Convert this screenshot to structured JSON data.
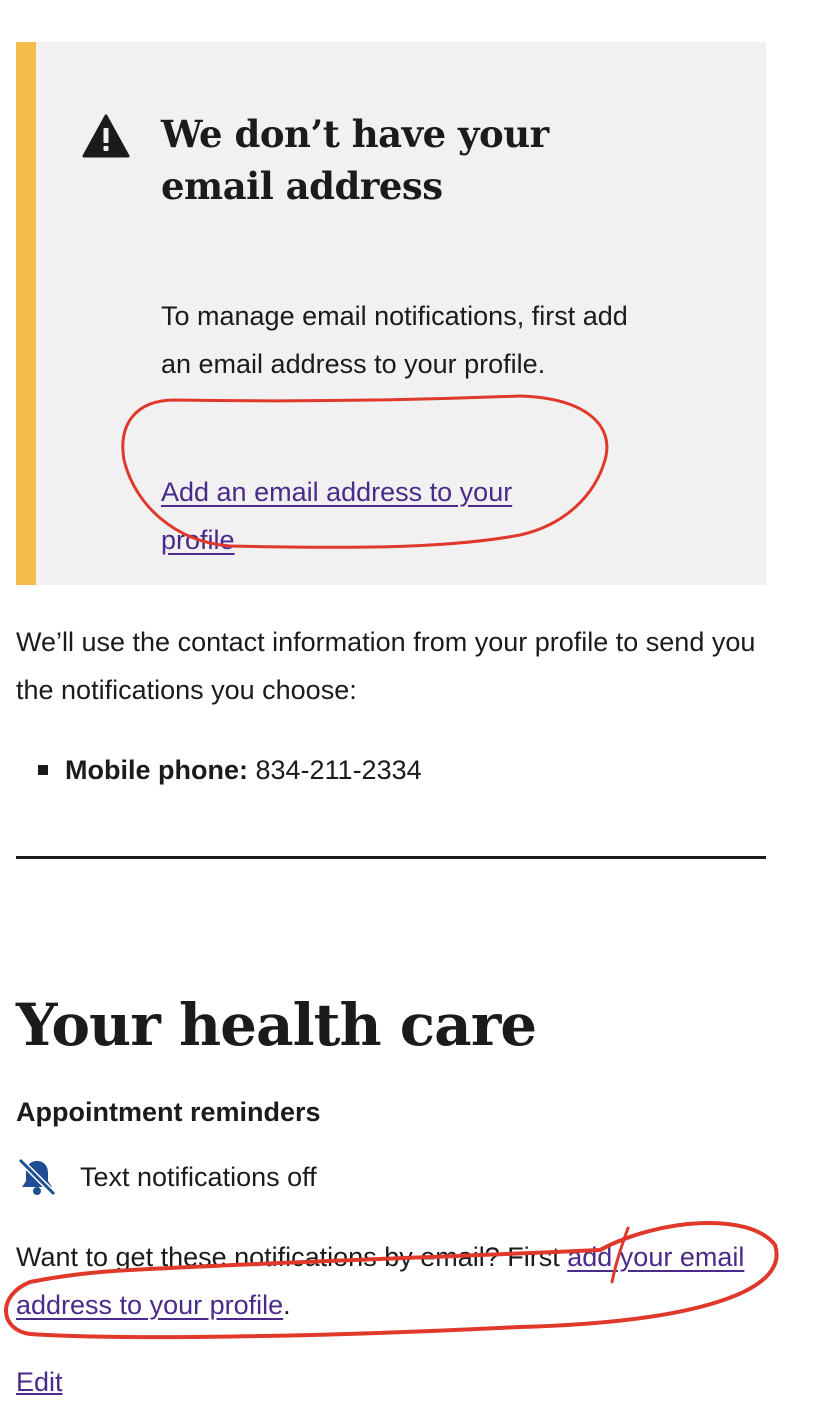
{
  "alert": {
    "heading": "We don’t have your email address",
    "body": "To manage email notifications, first add an email address to your profile.",
    "link_label": "Add an email address to your profile",
    "icon": "warning-icon",
    "accent_color": "#f4bc4a"
  },
  "contact": {
    "intro": "We’ll use the contact information from your profile to send you the notifications you choose:",
    "items": [
      {
        "label": "Mobile phone:",
        "value": " 834-211-2334"
      }
    ]
  },
  "health_care": {
    "title": "Your health care",
    "appointment_reminders": {
      "heading": "Appointment reminders",
      "status_icon": "bell-off-icon",
      "status": "Text notifications off",
      "prompt_text": "Want to get these notifications by email? First ",
      "prompt_link": "add your email address to your profile",
      "prompt_end": ".",
      "edit_label": "Edit"
    }
  },
  "colors": {
    "link": "#4a2a8a",
    "annotation": "#e0392b",
    "alert_background": "#f1f1f1"
  }
}
